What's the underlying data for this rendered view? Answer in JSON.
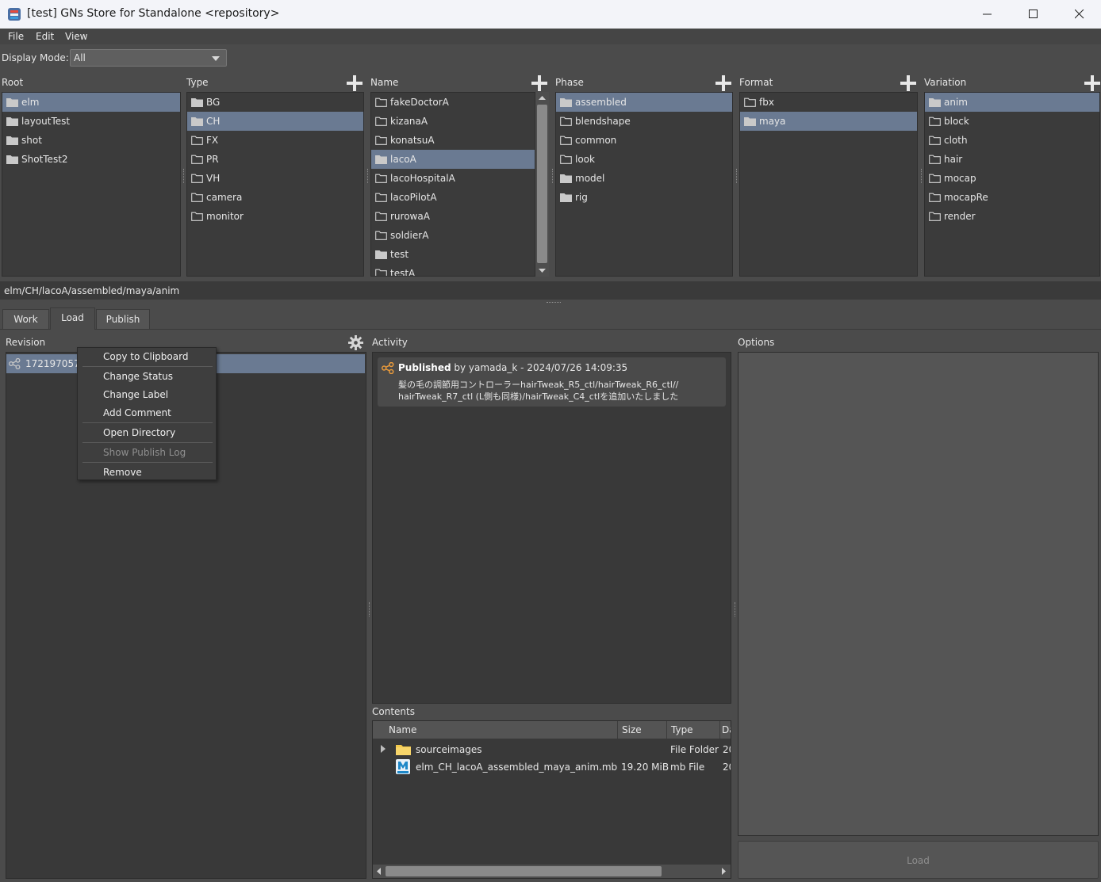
{
  "window": {
    "title": "[test] GNs Store for Standalone <repository>"
  },
  "menu": [
    "File",
    "Edit",
    "View"
  ],
  "display_mode": {
    "label": "Display Mode:",
    "value": "All"
  },
  "columns": {
    "root": {
      "header": "Root",
      "items": [
        "elm",
        "layoutTest",
        "shot",
        "ShotTest2"
      ],
      "selected": 0
    },
    "type": {
      "header": "Type",
      "items": [
        "BG",
        "CH",
        "FX",
        "PR",
        "VH",
        "camera",
        "monitor"
      ],
      "selected": 1
    },
    "name": {
      "header": "Name",
      "items": [
        "fakeDoctorA",
        "kizanaA",
        "konatsuA",
        "lacoA",
        "lacoHospitalA",
        "lacoPilotA",
        "rurowaA",
        "soldierA",
        "test",
        "testA"
      ],
      "selected": 3
    },
    "phase": {
      "header": "Phase",
      "items": [
        "assembled",
        "blendshape",
        "common",
        "look",
        "model",
        "rig"
      ],
      "selected": 0
    },
    "format": {
      "header": "Format",
      "items": [
        "fbx",
        "maya"
      ],
      "selected": 1
    },
    "variation": {
      "header": "Variation",
      "items": [
        "anim",
        "block",
        "cloth",
        "hair",
        "mocap",
        "mocapRe",
        "render"
      ],
      "selected": 0
    }
  },
  "path": "elm/CH/lacoA/assembled/maya/anim",
  "tabs": [
    "Work",
    "Load",
    "Publish"
  ],
  "active_tab": "Load",
  "revision": {
    "label": "Revision",
    "row_text": "172197057"
  },
  "context_menu": {
    "copy": "Copy to Clipboard",
    "change_status": "Change Status",
    "change_label": "Change Label",
    "add_comment": "Add Comment",
    "open_directory": "Open Directory",
    "show_publish_log": "Show Publish Log",
    "remove": "Remove"
  },
  "activity": {
    "label": "Activity",
    "status": "Published",
    "meta": " by yamada_k - 2024/07/26 14:09:35",
    "line1": "髪の毛の調節用コントローラーhairTweak_R5_ctl/hairTweak_R6_ctl//",
    "line2": "hairTweak_R7_ctl (L側も同様)/hairTweak_C4_ctlを追加いたしました"
  },
  "options": {
    "label": "Options",
    "load_button": "Load"
  },
  "contents": {
    "label": "Contents",
    "columns": [
      "Name",
      "Size",
      "Type",
      "Da"
    ],
    "rows": [
      {
        "name": "sourceimages",
        "size": "",
        "type": "File Folder",
        "date": "20"
      },
      {
        "name": "elm_CH_lacoA_assembled_maya_anim.mb",
        "size": "19.20 MiB",
        "type": "mb File",
        "date": "20"
      }
    ]
  },
  "colors": {
    "selection": "#6a7a92",
    "panel": "#393939",
    "background": "#4b4b4b",
    "icon_orange": "#e89a3c",
    "folder_yellow": "#f2c94c",
    "maya_blue": "#1e88c8"
  }
}
